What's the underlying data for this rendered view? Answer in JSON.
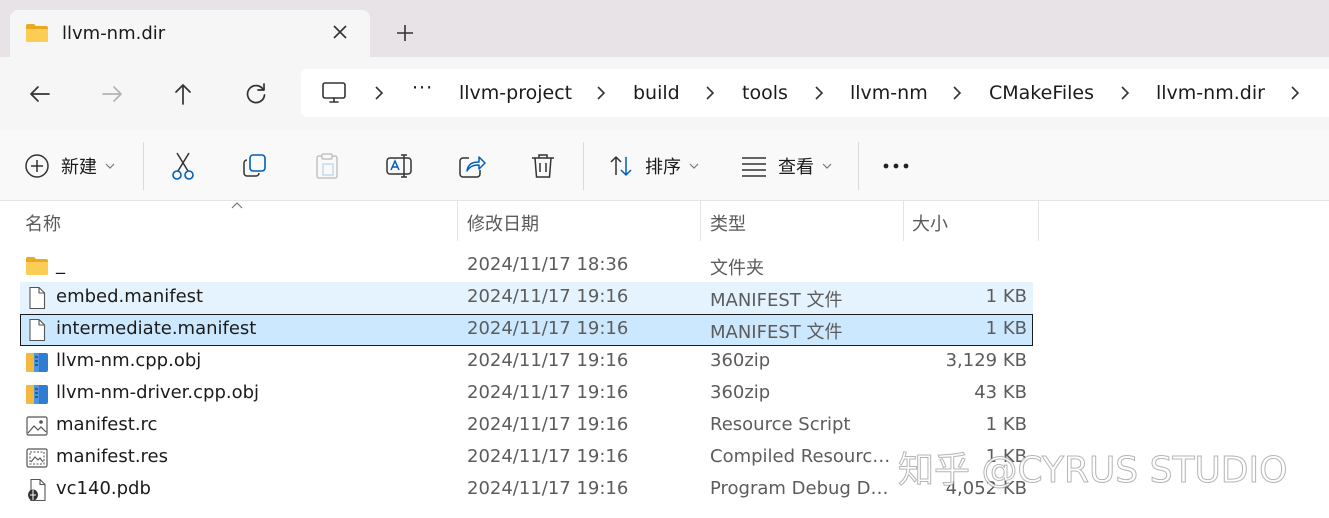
{
  "tab": {
    "title": "llvm-nm.dir",
    "icon": "folder-icon",
    "close_icon": "close-icon",
    "new_tab_icon": "plus-icon"
  },
  "nav": {
    "back": "back-arrow-icon",
    "forward": "forward-arrow-icon",
    "up": "up-arrow-icon",
    "refresh": "refresh-icon"
  },
  "breadcrumb": {
    "root_icon": "this-pc-icon",
    "overflow": "···",
    "items": [
      "llvm-project",
      "build",
      "tools",
      "llvm-nm",
      "CMakeFiles",
      "llvm-nm.dir"
    ]
  },
  "toolbar": {
    "new_label": "新建",
    "sort_label": "排序",
    "view_label": "查看",
    "more": "···",
    "icons": [
      "cut-icon",
      "copy-icon",
      "paste-icon",
      "rename-icon",
      "share-icon",
      "delete-icon"
    ]
  },
  "columns": {
    "name": "名称",
    "date": "修改日期",
    "type": "类型",
    "size": "大小"
  },
  "files": [
    {
      "name": "_",
      "date": "2024/11/17 18:36",
      "type": "文件夹",
      "size": "",
      "icon": "folder-icon",
      "state": "normal"
    },
    {
      "name": "embed.manifest",
      "date": "2024/11/17 19:16",
      "type": "MANIFEST 文件",
      "size": "1 KB",
      "icon": "file-icon",
      "state": "hover"
    },
    {
      "name": "intermediate.manifest",
      "date": "2024/11/17 19:16",
      "type": "MANIFEST 文件",
      "size": "1 KB",
      "icon": "file-icon",
      "state": "selected"
    },
    {
      "name": "llvm-nm.cpp.obj",
      "date": "2024/11/17 19:16",
      "type": "360zip",
      "size": "3,129 KB",
      "icon": "archive-icon",
      "state": "normal"
    },
    {
      "name": "llvm-nm-driver.cpp.obj",
      "date": "2024/11/17 19:16",
      "type": "360zip",
      "size": "43 KB",
      "icon": "archive-icon",
      "state": "normal"
    },
    {
      "name": "manifest.rc",
      "date": "2024/11/17 19:16",
      "type": "Resource Script",
      "size": "1 KB",
      "icon": "image-file-icon",
      "state": "normal"
    },
    {
      "name": "manifest.res",
      "date": "2024/11/17 19:16",
      "type": "Compiled Resource...",
      "size": "1 KB",
      "icon": "resource-file-icon",
      "state": "normal"
    },
    {
      "name": "vc140.pdb",
      "date": "2024/11/17 19:16",
      "type": "Program Debug Da...",
      "size": "4,052 KB",
      "icon": "debug-file-icon",
      "state": "normal"
    }
  ],
  "watermark": "知乎 @CYRUS STUDIO",
  "colors": {
    "hover": "#e5f3ff",
    "selected": "#cce8ff",
    "folder": "#f8c94a",
    "accent": "#005fb8"
  }
}
